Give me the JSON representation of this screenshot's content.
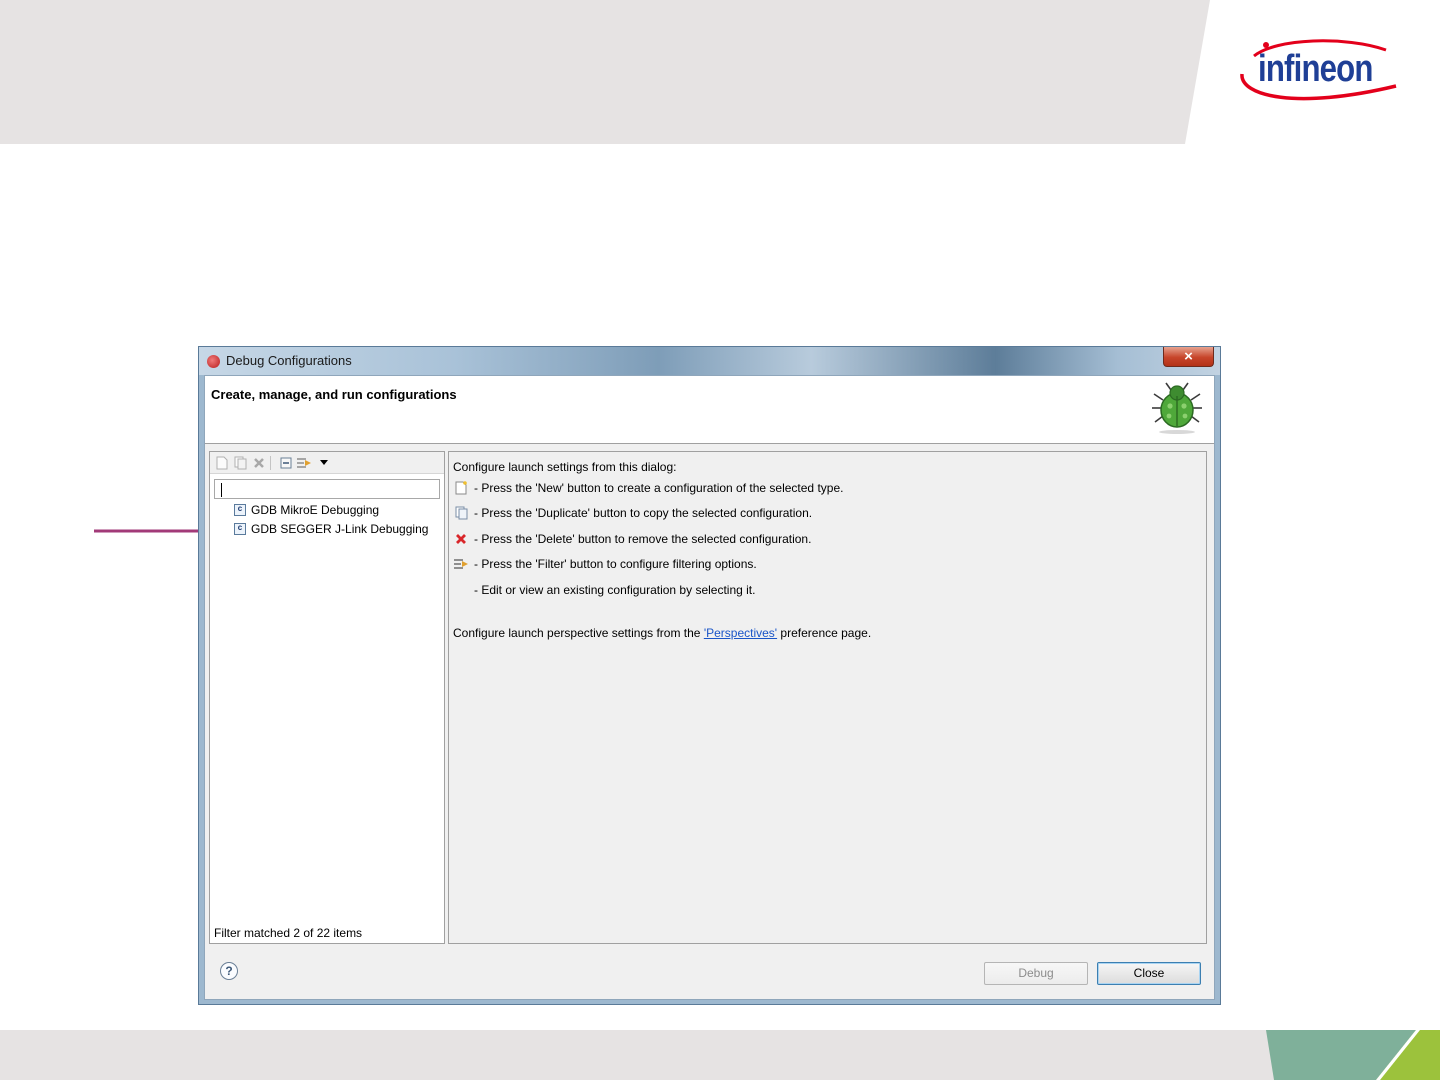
{
  "slide": {
    "brand": "infineon",
    "colors": {
      "header_band": "#e6e3e3",
      "arrow": "#a23a78",
      "brand_blue": "#1f3f96",
      "brand_red": "#e3001b",
      "accent_green": "#7fb09a"
    }
  },
  "window": {
    "title": "Debug Configurations",
    "close_label": "×"
  },
  "banner": {
    "title": "Create, manage, and run configurations",
    "icon": "bug-icon"
  },
  "left_pane": {
    "toolbar": [
      "new-config-icon",
      "duplicate-icon",
      "delete-icon",
      "collapse-all-icon",
      "filter-icon",
      "dropdown-icon"
    ],
    "filter_value": "",
    "items": [
      {
        "label": "GDB MikroE Debugging",
        "icon": "c-config-icon"
      },
      {
        "label": "GDB SEGGER J-Link Debugging",
        "icon": "c-config-icon"
      }
    ],
    "status": "Filter matched 2 of 22 items"
  },
  "right_pane": {
    "intro": "Configure launch settings from this dialog:",
    "rows": [
      {
        "icon": "new-config-icon",
        "text": "- Press the 'New' button to create a configuration of the selected type."
      },
      {
        "icon": "duplicate-icon",
        "text": "- Press the 'Duplicate' button to copy the selected configuration."
      },
      {
        "icon": "delete-icon",
        "text": "- Press the 'Delete' button to remove the selected configuration."
      },
      {
        "icon": "filter-icon",
        "text": "- Press the 'Filter' button to configure filtering options."
      },
      {
        "icon": "",
        "text": "- Edit or view an existing configuration by selecting it."
      }
    ],
    "perspective_prefix": "Configure launch perspective settings from the ",
    "perspective_link": "'Perspectives'",
    "perspective_suffix": " preference page."
  },
  "footer": {
    "help_label": "?",
    "debug_label": "Debug",
    "close_label": "Close"
  }
}
